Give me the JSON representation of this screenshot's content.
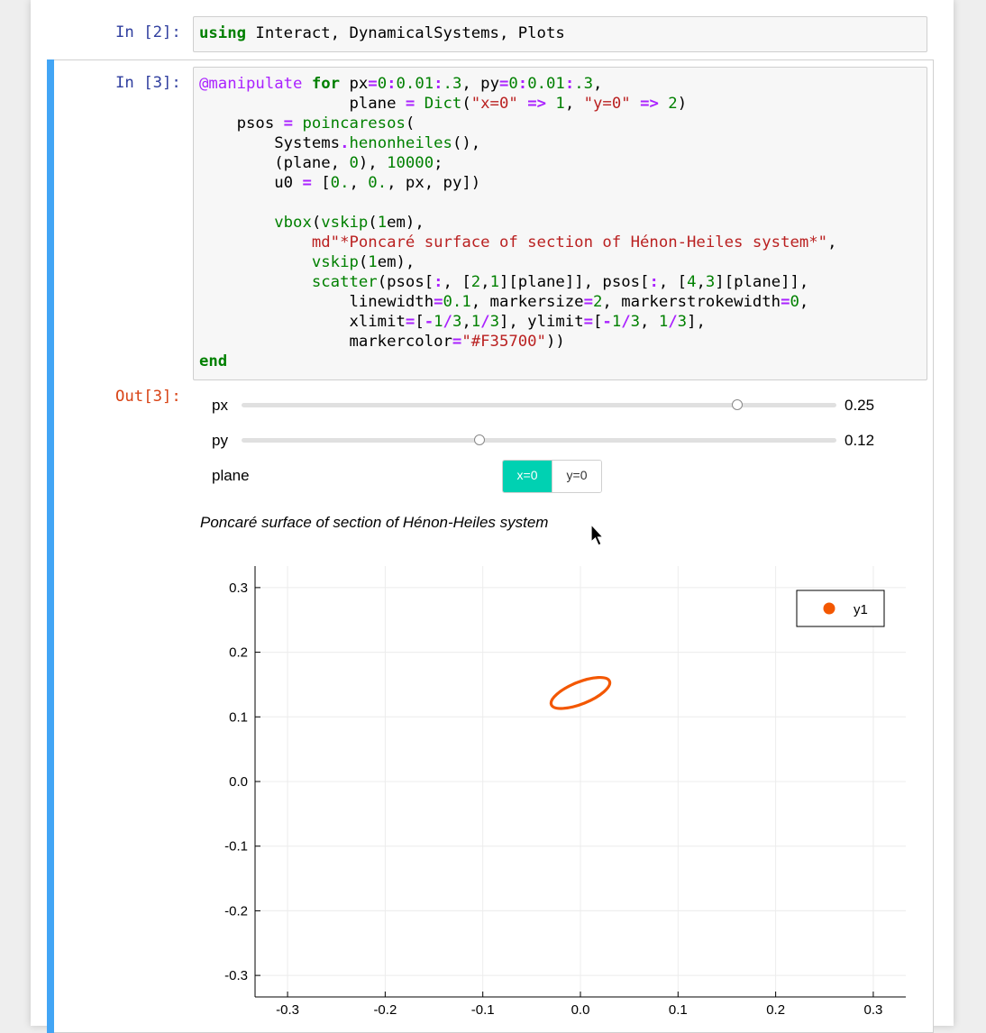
{
  "cells": {
    "cell1": {
      "prompt": "In [2]:",
      "code": "using Interact, DynamicalSystems, Plots"
    },
    "cell2": {
      "prompt": "In [3]:",
      "out_prompt": "Out[3]:"
    }
  },
  "widgets": {
    "px": {
      "label": "px",
      "value_text": "0.25",
      "value": 0.25,
      "min": 0,
      "max": 0.3
    },
    "py": {
      "label": "py",
      "value_text": "0.12",
      "value": 0.12,
      "min": 0,
      "max": 0.3
    },
    "plane": {
      "label": "plane",
      "options": [
        "x=0",
        "y=0"
      ],
      "selected": "x=0"
    }
  },
  "output_title": "Poncaré surface of section of Hénon-Heiles system",
  "colors": {
    "accent": "#00d1b2",
    "marker": "#F35700",
    "selection_bar": "#42a5f5"
  },
  "chart_data": {
    "type": "scatter",
    "title": "",
    "xlabel": "",
    "ylabel": "",
    "xlim": [
      -0.3333,
      0.3333
    ],
    "ylim": [
      -0.3333,
      0.3333
    ],
    "xticks": [
      "-0.3",
      "-0.2",
      "-0.1",
      "0.0",
      "0.1",
      "0.2",
      "0.3"
    ],
    "yticks": [
      "0.3",
      "0.2",
      "0.1",
      "0.0",
      "-0.1",
      "-0.2",
      "-0.3"
    ],
    "grid": true,
    "legend_position": "top-right",
    "series": [
      {
        "name": "y1",
        "color": "#F35700",
        "shape": "ellipse",
        "center": [
          0.0,
          0.137
        ],
        "x_range": [
          -0.03,
          0.033
        ],
        "y_range": [
          0.105,
          0.17
        ],
        "tilt_deg": -22
      }
    ]
  }
}
